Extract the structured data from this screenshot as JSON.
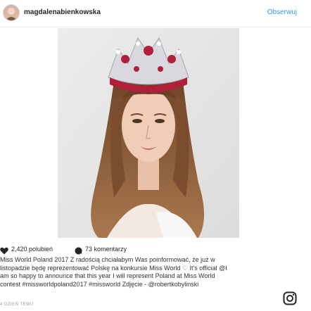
{
  "post": {
    "username": "magdalenabienkowska",
    "follow_label": "Obserwuj",
    "likes": "2,420 polubień",
    "comments": "73 komentarzy",
    "caption_lines": [
      "Miss World Poland 2017 Z radością chciałabym Was poinformować, że już w",
      "listopadzie będę reprezentować Polskę na konkursie Miss World ♡ It's official @I",
      "am so happy to announce that this year I will represent Poland at Miss World",
      "contest #missworldpoland2017 #missworld Zdjęcie - @robertkobylinski"
    ],
    "date": "4 DZIEŃ TEMU"
  },
  "icons": {
    "like": "heart-icon",
    "comment": "speech-bubble-icon",
    "brand": "instagram-icon"
  },
  "colors": {
    "link_blue": "#3897f0",
    "text_dark": "#262626",
    "crown_red": "#b0203a",
    "hair_brown": "#8a5a36"
  }
}
